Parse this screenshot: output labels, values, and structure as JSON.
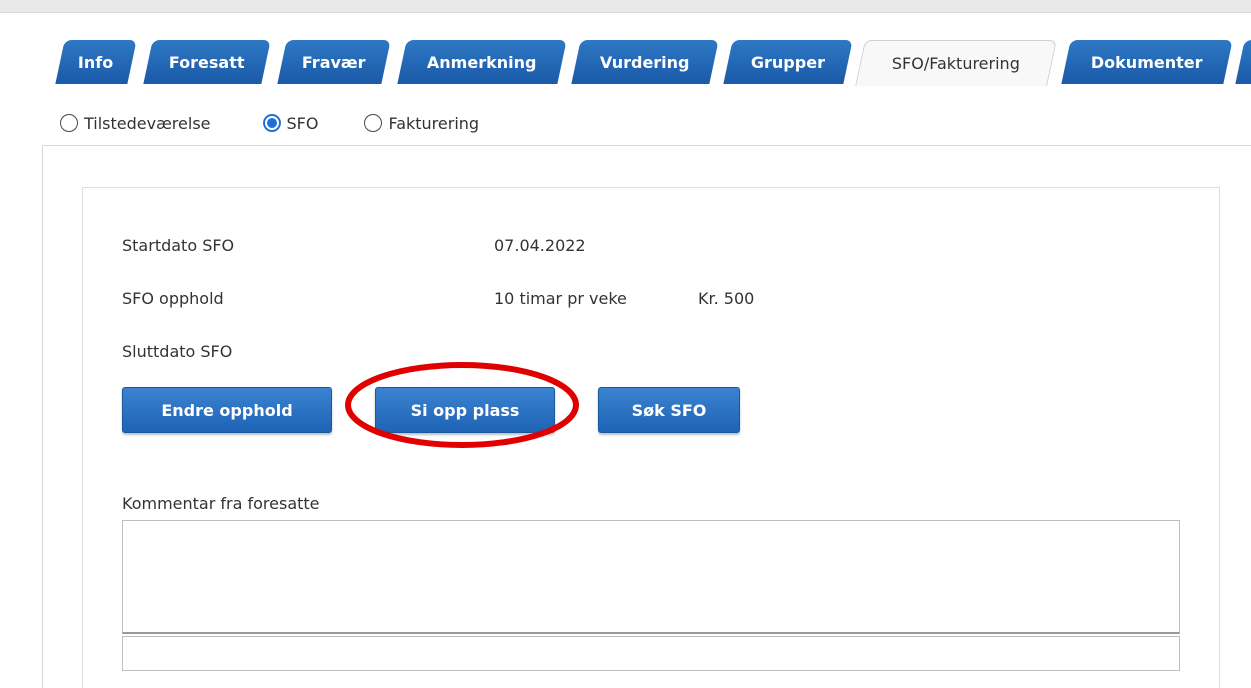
{
  "tabs": [
    {
      "label": "Info",
      "active": false
    },
    {
      "label": "Foresatt",
      "active": false
    },
    {
      "label": "Fravær",
      "active": false
    },
    {
      "label": "Anmerkning",
      "active": false
    },
    {
      "label": "Vurdering",
      "active": false
    },
    {
      "label": "Grupper",
      "active": false
    },
    {
      "label": "SFO/Fakturering",
      "active": true
    },
    {
      "label": "Dokumenter",
      "active": false
    }
  ],
  "view_options": [
    {
      "label": "Tilstedeværelse",
      "checked": false
    },
    {
      "label": "SFO",
      "checked": true
    },
    {
      "label": "Fakturering",
      "checked": false
    }
  ],
  "sfo": {
    "start_label": "Startdato SFO",
    "start_value": "07.04.2022",
    "stay_label": "SFO opphold",
    "stay_value": "10 timar pr veke",
    "stay_price": "Kr. 500",
    "end_label": "Sluttdato SFO",
    "end_value": ""
  },
  "buttons": {
    "change_stay": "Endre opphold",
    "cancel_place": "Si opp plass",
    "apply_sfo": "Søk SFO"
  },
  "comment": {
    "label": "Kommentar fra foresatte",
    "value": ""
  },
  "colors": {
    "tab_blue": "#1a5aa8",
    "button_blue": "#2a70c2",
    "radio_checked": "#1e6fd9",
    "highlight_red": "#e00000"
  }
}
